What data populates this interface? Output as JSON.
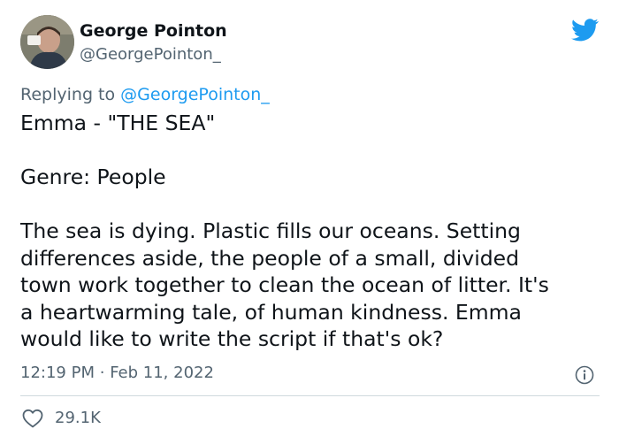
{
  "author": {
    "display_name": "George Pointon",
    "handle": "@GeorgePointon_"
  },
  "reply": {
    "prefix": "Replying to",
    "mention": "@GeorgePointon_"
  },
  "tweet": {
    "title": "Emma - \"THE SEA\"",
    "genre": "Genre: People",
    "lines": [
      "The sea is dying. Plastic fills our oceans. Setting",
      "differences aside, the people of a small, divided",
      "town work together to clean the ocean of litter. It's",
      "a heartwarming tale, of human kindness. Emma",
      "would like to write the script if that's ok?"
    ]
  },
  "meta": {
    "time": "12:19 PM",
    "separator": "·",
    "date": "Feb 11, 2022"
  },
  "engagement": {
    "likes": "29.1K"
  },
  "icons": {
    "brand": "twitter-bird-icon",
    "info": "info-icon",
    "like": "heart-icon"
  },
  "colors": {
    "brand_blue": "#1d9bf0",
    "secondary_text": "#536471",
    "primary_text": "#0f1419",
    "divider": "#cfd9de"
  }
}
